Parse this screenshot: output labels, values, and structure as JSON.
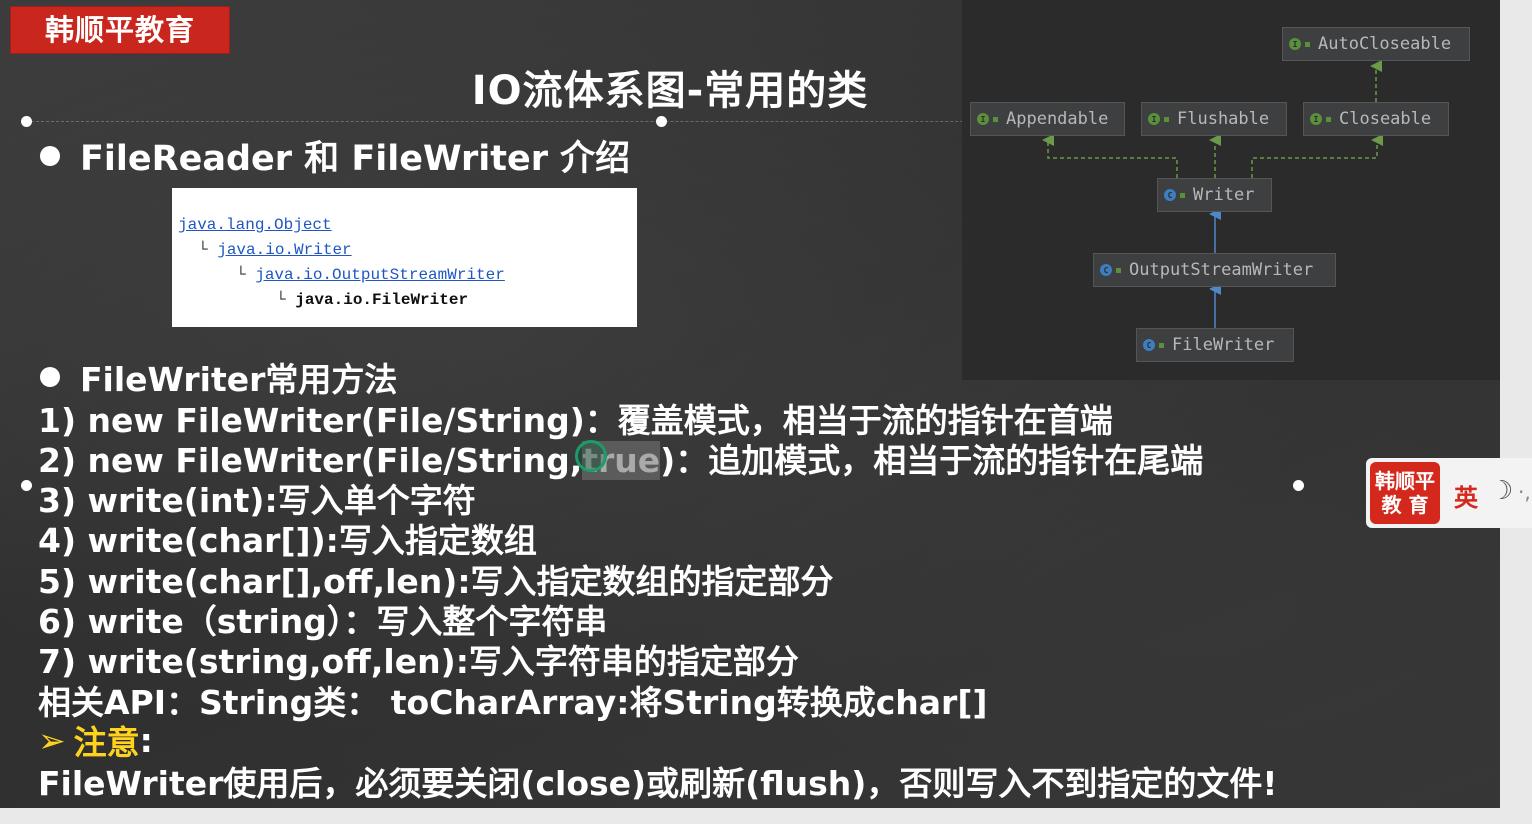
{
  "brand": {
    "logo_text": "韩顺平教育"
  },
  "slide": {
    "title": "IO流体系图-常用的类",
    "section1": "FileReader 和 FileWriter 介绍",
    "hierarchy": [
      {
        "text": "java.lang.Object",
        "link": true
      },
      {
        "prefix": "└",
        "text": "java.io.Writer",
        "link": true
      },
      {
        "prefix": "└",
        "text": "java.io.OutputStreamWriter",
        "link": true
      },
      {
        "prefix": "└",
        "text": "java.io.FileWriter",
        "link": false
      }
    ],
    "section2": "FileWriter常用方法",
    "method1": "1) new FileWriter(File/String)：覆盖模式，相当于流的指针在首端",
    "method2_pre": "2) new FileWriter(File/String,",
    "method2_hl": "true",
    "method2_post": ")：追加模式，相当于流的指针在尾端",
    "method3": "3) write(int):写入单个字符",
    "method4": "4) write(char[]):写入指定数组",
    "method5": "5) write(char[],off,len):写入指定数组的指定部分",
    "method6": "6) write（string）：写入整个字符串",
    "method7": "7) write(string,off,len):写入字符串的指定部分",
    "related_api": "相关API：String类： toCharArray:将String转换成char[]",
    "note_label": "注意",
    "note_colon": ":",
    "note_text": "FileWriter使用后，必须要关闭(close)或刷新(flush)，否则写入不到指定的文件!"
  },
  "uml": {
    "nodes": {
      "autocloseable": "AutoCloseable",
      "appendable": "Appendable",
      "flushable": "Flushable",
      "closeable": "Closeable",
      "writer": "Writer",
      "outputstreamwriter": "OutputStreamWriter",
      "filewriter": "FileWriter"
    },
    "interface_icon": "I",
    "class_icon": "C",
    "colors": {
      "interface": "#5a8f3c",
      "class": "#3d7ebf",
      "implements": "#6b9a4b",
      "extends": "#4f87c9"
    }
  },
  "widget": {
    "logo_line1": "韩顺平",
    "logo_line2": "教 育",
    "ime_label": "英",
    "moon_icon": "☽",
    "extra": "·,"
  }
}
